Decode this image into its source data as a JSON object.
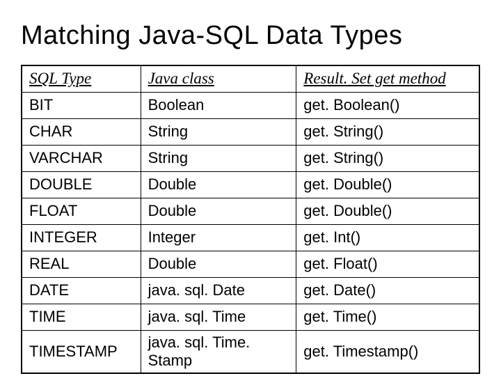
{
  "title": "Matching Java-SQL Data Types",
  "headers": {
    "col1": "SQL Type",
    "col2": "Java class",
    "col3": "Result. Set get method"
  },
  "rows": [
    {
      "sql": "BIT",
      "java": "Boolean",
      "method": "get. Boolean()"
    },
    {
      "sql": "CHAR",
      "java": "String",
      "method": "get. String()"
    },
    {
      "sql": "VARCHAR",
      "java": "String",
      "method": "get. String()"
    },
    {
      "sql": "DOUBLE",
      "java": "Double",
      "method": "get. Double()"
    },
    {
      "sql": "FLOAT",
      "java": "Double",
      "method": "get. Double()"
    },
    {
      "sql": "INTEGER",
      "java": "Integer",
      "method": "get. Int()"
    },
    {
      "sql": "REAL",
      "java": "Double",
      "method": "get. Float()"
    },
    {
      "sql": "DATE",
      "java": "java. sql. Date",
      "method": "get. Date()"
    },
    {
      "sql": "TIME",
      "java": "java. sql. Time",
      "method": "get. Time()"
    },
    {
      "sql": "TIMESTAMP",
      "java": "java. sql. Time. Stamp",
      "method": "get. Timestamp()"
    }
  ]
}
